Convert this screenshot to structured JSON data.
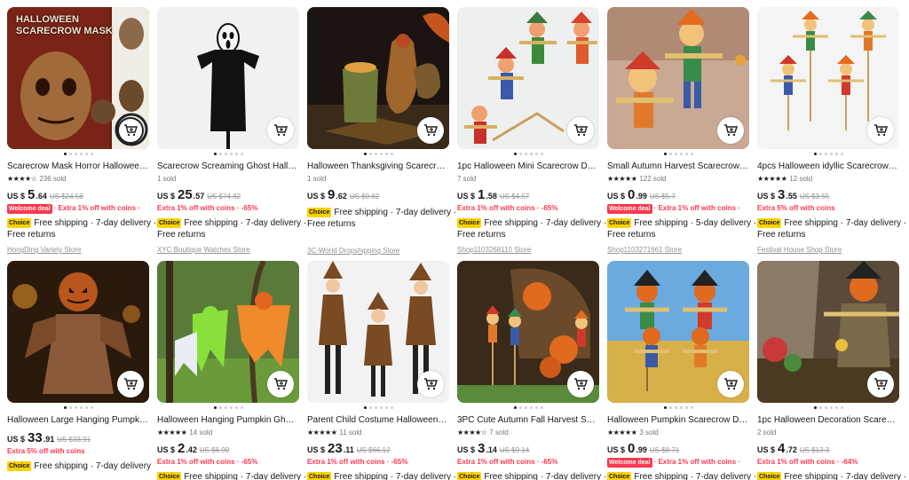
{
  "row1": [
    {
      "thumb_title": "HALLOWEEN\nSCARECROW MASK",
      "title": "Scarecrow Mask Horror Halloween ...",
      "stars": "★★★★☆",
      "sold": "236 sold",
      "cur": "US $",
      "price": "5",
      "cents": ".64",
      "old": "US $24.58",
      "welcome": "Welcome deal",
      "deal": "· Extra 1% off with coins ·",
      "ship1": "Free shipping · 7-day delivery ·",
      "returns": "Free returns",
      "store": "HongDing Variety Store",
      "cart_icon": "cart-icon"
    },
    {
      "thumb_title": "",
      "title": "Scarecrow Screaming Ghost Hallow...",
      "stars": "",
      "sold": "1 sold",
      "cur": "US $",
      "price": "25",
      "cents": ".57",
      "old": "US $74.32",
      "welcome": "",
      "deal": "Extra 1% off with coins · -65%",
      "ship1": "Free shipping · 7-day delivery ·",
      "returns": "Free returns",
      "store": "XYC Boutique Watches Store",
      "cart_icon": "cart-icon"
    },
    {
      "thumb_title": "",
      "title": "Halloween Thanksgiving Scarecrow ...",
      "stars": "",
      "sold": "1 sold",
      "cur": "US $",
      "price": "9",
      "cents": ".62",
      "old": "US $9.62",
      "welcome": "",
      "deal": "",
      "ship1": "Free shipping · 7-day delivery ·",
      "returns": "Free returns",
      "store": "3C-World Dropshipping Store",
      "cart_icon": "cart-icon"
    },
    {
      "thumb_title": "",
      "title": "1pc Halloween Mini Scarecrow Deco...",
      "stars": "",
      "sold": "7 sold",
      "cur": "US $",
      "price": "1",
      "cents": ".58",
      "old": "US $4.57",
      "welcome": "",
      "deal": "Extra 1% off with coins · -65%",
      "ship1": "Free shipping · 7-day delivery ·",
      "returns": "Free returns",
      "store": "Shop1103268110 Store",
      "cart_icon": "cart-icon"
    },
    {
      "thumb_title": "",
      "title": "Small Autumn Harvest Scarecrow D...",
      "stars": "★★★★★",
      "sold": "122 sold",
      "cur": "US $",
      "price": "0",
      "cents": ".99",
      "old": "US $5.7",
      "welcome": "Welcome deal",
      "deal": "· Extra 1% off with coins ·",
      "ship1": "Free shipping · 5-day delivery ·",
      "returns": "Free returns",
      "store": "Shop1103271661 Store",
      "cart_icon": "cart-icon"
    },
    {
      "thumb_title": "",
      "title": "4pcs Halloween idyllic Scarecrow Ad...",
      "stars": "★★★★★",
      "sold": "12 sold",
      "cur": "US $",
      "price": "3",
      "cents": ".55",
      "old": "US $3.55",
      "welcome": "",
      "deal": "Extra 5% off with coins",
      "ship1": "Free shipping · 7-day delivery ·",
      "returns": "Free returns",
      "store": "Festival House Shop Store",
      "cart_icon": "cart-icon"
    }
  ],
  "row2": [
    {
      "title": "Halloween Large Hanging Pumpkin ...",
      "stars": "",
      "sold": "",
      "cur": "US $",
      "price": "33",
      "cents": ".91",
      "old": "US $33.91",
      "welcome": "",
      "deal": "Extra 5% off with coins",
      "ship1": "Free shipping · 7-day delivery",
      "cart_icon": "cart-icon"
    },
    {
      "title": "Halloween Hanging Pumpkin Ghost ...",
      "stars": "★★★★★",
      "sold": "14 sold",
      "cur": "US $",
      "price": "2",
      "cents": ".42",
      "old": "US $6.99",
      "welcome": "",
      "deal": "Extra 1% off with coins · -65%",
      "ship1": "Free shipping · 7-day delivery ·",
      "cart_icon": "cart-icon"
    },
    {
      "title": "Parent Child Costume Halloween Wi...",
      "stars": "★★★★★",
      "sold": "11 sold",
      "cur": "US $",
      "price": "23",
      "cents": ".11",
      "old": "US $66.12",
      "welcome": "",
      "deal": "Extra 1% off with coins · -65%",
      "ship1": "Free shipping · 7-day delivery ·",
      "cart_icon": "cart-icon"
    },
    {
      "title": "3PC Cute Autumn Fall Harvest Scare...",
      "stars": "★★★★☆",
      "sold": "7 sold",
      "cur": "US $",
      "price": "3",
      "cents": ".14",
      "old": "US $9.14",
      "welcome": "",
      "deal": "Extra 1% off with coins · -65%",
      "ship1": "Free shipping · 7-day delivery ·",
      "cart_icon": "cart-icon"
    },
    {
      "title": "Halloween Pumpkin Scarecrow Doll...",
      "stars": "★★★★★",
      "sold": "3 sold",
      "cur": "US $",
      "price": "0",
      "cents": ".99",
      "old": "US $8.71",
      "welcome": "Welcome deal",
      "deal": "· Extra 1% off with coins ·",
      "ship1": "Free shipping · 7-day delivery ·",
      "cart_icon": "cart-icon"
    },
    {
      "title": "1pc Halloween Decoration Scarecro...",
      "stars": "",
      "sold": "2 sold",
      "cur": "US $",
      "price": "4",
      "cents": ".72",
      "old": "US $13.3",
      "welcome": "",
      "deal": "Extra 1% off with coins · -64%",
      "ship1": "Free shipping · 7-day delivery ·",
      "cart_icon": "cart-icon"
    }
  ],
  "choice_label": "Choice",
  "colors": {
    "accent": "#fd384f",
    "choice": "#fcd202",
    "text": "#191919",
    "muted": "#757575"
  }
}
